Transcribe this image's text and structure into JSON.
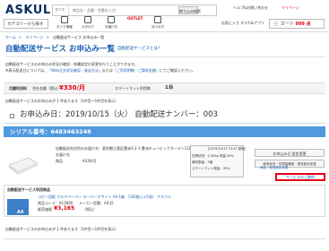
{
  "header": {
    "logo": "ASKUL",
    "search_category": "すべて",
    "search_placeholder": "商品名・品番・型番を入力",
    "search_button": "絞り込み検索",
    "links": [
      "ヘルプ&お問い合わせ",
      "マイページ"
    ],
    "login": "ログイン",
    "members_links": [
      "お気に入り",
      "スマホ&アプリ"
    ],
    "category_select": "カテゴリーから探す",
    "nav_icons": [
      "おトク情報",
      "カタログ",
      "お届け日",
      "OUTLET",
      "法人の方"
    ],
    "cart_label": "カート",
    "cart_value": "999 点"
  },
  "breadcrumb": [
    "ホーム",
    "マイページ",
    "自動配送サービス お申込み一覧"
  ],
  "page": {
    "title": "自動配送サービス お申込み一覧",
    "help_link": "自動配送サービスとは？",
    "desc1": "自動配送サービスのお申込み状況の確認・各種設定の変更を行うことができます。",
    "desc2_pre": "※表示配送日については、",
    "desc2_link1": "「Web注文状況確認・発送方法」",
    "desc2_mid": "または",
    "desc2_link2": "「ご利用明細・ご請求金額」",
    "desc2_post": "にてご確認ください。"
  },
  "summary": {
    "label": "月額利用料",
    "tax_note": "合計金額（税込）",
    "amount": "¥330/月",
    "count_label": "スマートマット利用数",
    "count": "1台"
  },
  "notice1": "自動配送サービスのお申込みが 1 件あります（1件目〜1件目を表示）",
  "order": {
    "date_line": "お申込み日：2019/10/15（火） 自動配送ナンバー：003",
    "serial_label": "シリアル番号：",
    "serial": "6483463248",
    "addr_line": "自動配送先住所のお届け先：東京都江東区豊洲3-2-3 豊洲キュービックガーデン11階",
    "product_label1": "お届け先",
    "product_label2": "商品",
    "price": "¥330/月",
    "info_date": "[2019/10/17 15:43 更新]",
    "info_rows": [
      "在庫状況：1,509g 残量 30%",
      "補充数量：5個",
      "スマートマット残量：30%"
    ],
    "side_buttons": [
      "お申込み日 設定変更",
      "使用状況・在庫量確認・発送設定変更",
      "商品・配送設定変更"
    ],
    "highlight_button": "サービスのご解約"
  },
  "detail": {
    "title": "自動配送サービス利用商品",
    "links": [
      "コピー用紙",
      "マルチペーパー",
      "スーパーホワイト",
      "A4",
      "1箱",
      "（500枚入×5冊）",
      "アスクル"
    ],
    "code_label": "商品コード：613690",
    "maker": "メーカー型番：A4-J5",
    "price_label": "販売価格",
    "price": "¥3,165",
    "price_note": "（税込）",
    "pack_label": "A4"
  },
  "notice2": "自動配送サービスのお申込みが 1 件あります（1件目〜1件目を表示）",
  "colors": {
    "accent": "#e60012",
    "link": "#1a5fb4",
    "serial_bar": "#4f9ae0"
  }
}
